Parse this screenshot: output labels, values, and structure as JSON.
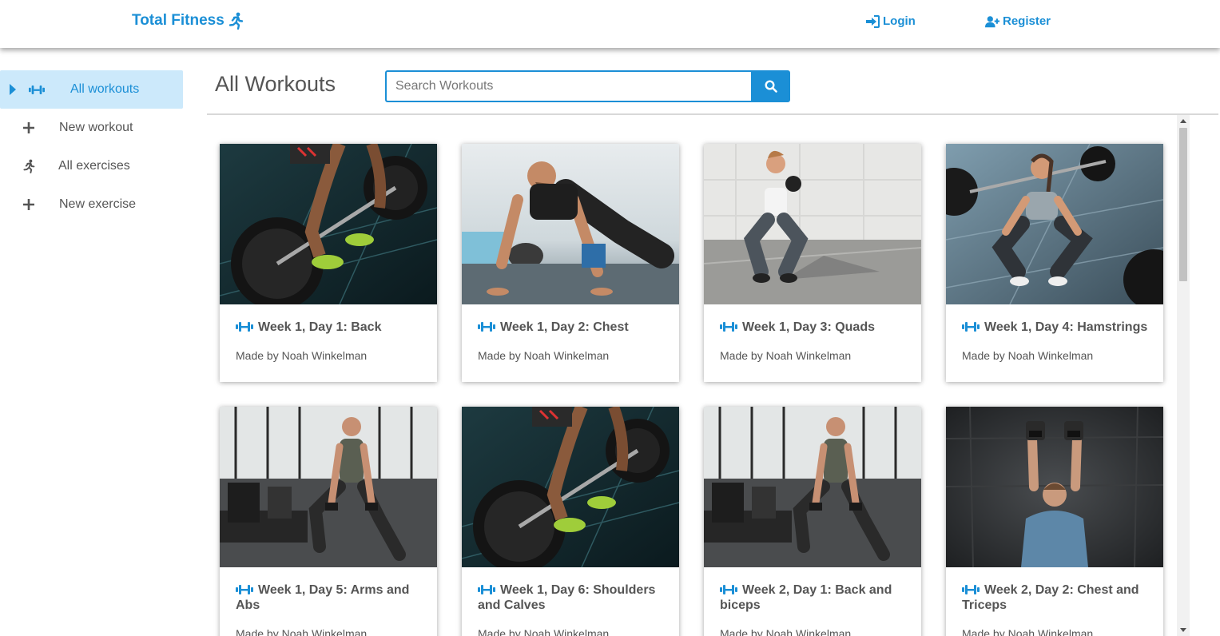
{
  "header": {
    "brand": "Total Fitness",
    "login_label": "Login",
    "register_label": "Register"
  },
  "sidebar": {
    "items": [
      {
        "label": "All workouts",
        "icon": "dumbbell-icon",
        "active": true
      },
      {
        "label": "New workout",
        "icon": "plus-icon"
      },
      {
        "label": "All exercises",
        "icon": "running-icon"
      },
      {
        "label": "New exercise",
        "icon": "plus-icon"
      }
    ]
  },
  "main": {
    "title": "All Workouts",
    "search_placeholder": "Search Workouts",
    "cards": [
      {
        "title": "Week 1, Day 1: Back",
        "author": "Made by Noah Winkelman",
        "image": "deadlift-photo"
      },
      {
        "title": "Week 1, Day 2: Chest",
        "author": "Made by Noah Winkelman",
        "image": "pushup-photo"
      },
      {
        "title": "Week 1, Day 3: Quads",
        "author": "Made by Noah Winkelman",
        "image": "goblet-squat-photo"
      },
      {
        "title": "Week 1, Day 4: Hamstrings",
        "author": "Made by Noah Winkelman",
        "image": "gym-woman-photo"
      },
      {
        "title": "Week 1, Day 5: Arms and Abs",
        "author": "Made by Noah Winkelman",
        "image": "lunge-gym-photo"
      },
      {
        "title": "Week 1, Day 6: Shoulders and Calves",
        "author": "Made by Noah Winkelman",
        "image": "deadlift-photo"
      },
      {
        "title": "Week 2, Day 1: Back and biceps",
        "author": "Made by Noah Winkelman",
        "image": "lunge-gym-photo"
      },
      {
        "title": "Week 2, Day 2: Chest and Triceps",
        "author": "Made by Noah Winkelman",
        "image": "dumbbell-press-photo"
      }
    ]
  },
  "colors": {
    "accent": "#1b8fd6",
    "active_bg": "#cce9fb",
    "text": "#555555"
  }
}
